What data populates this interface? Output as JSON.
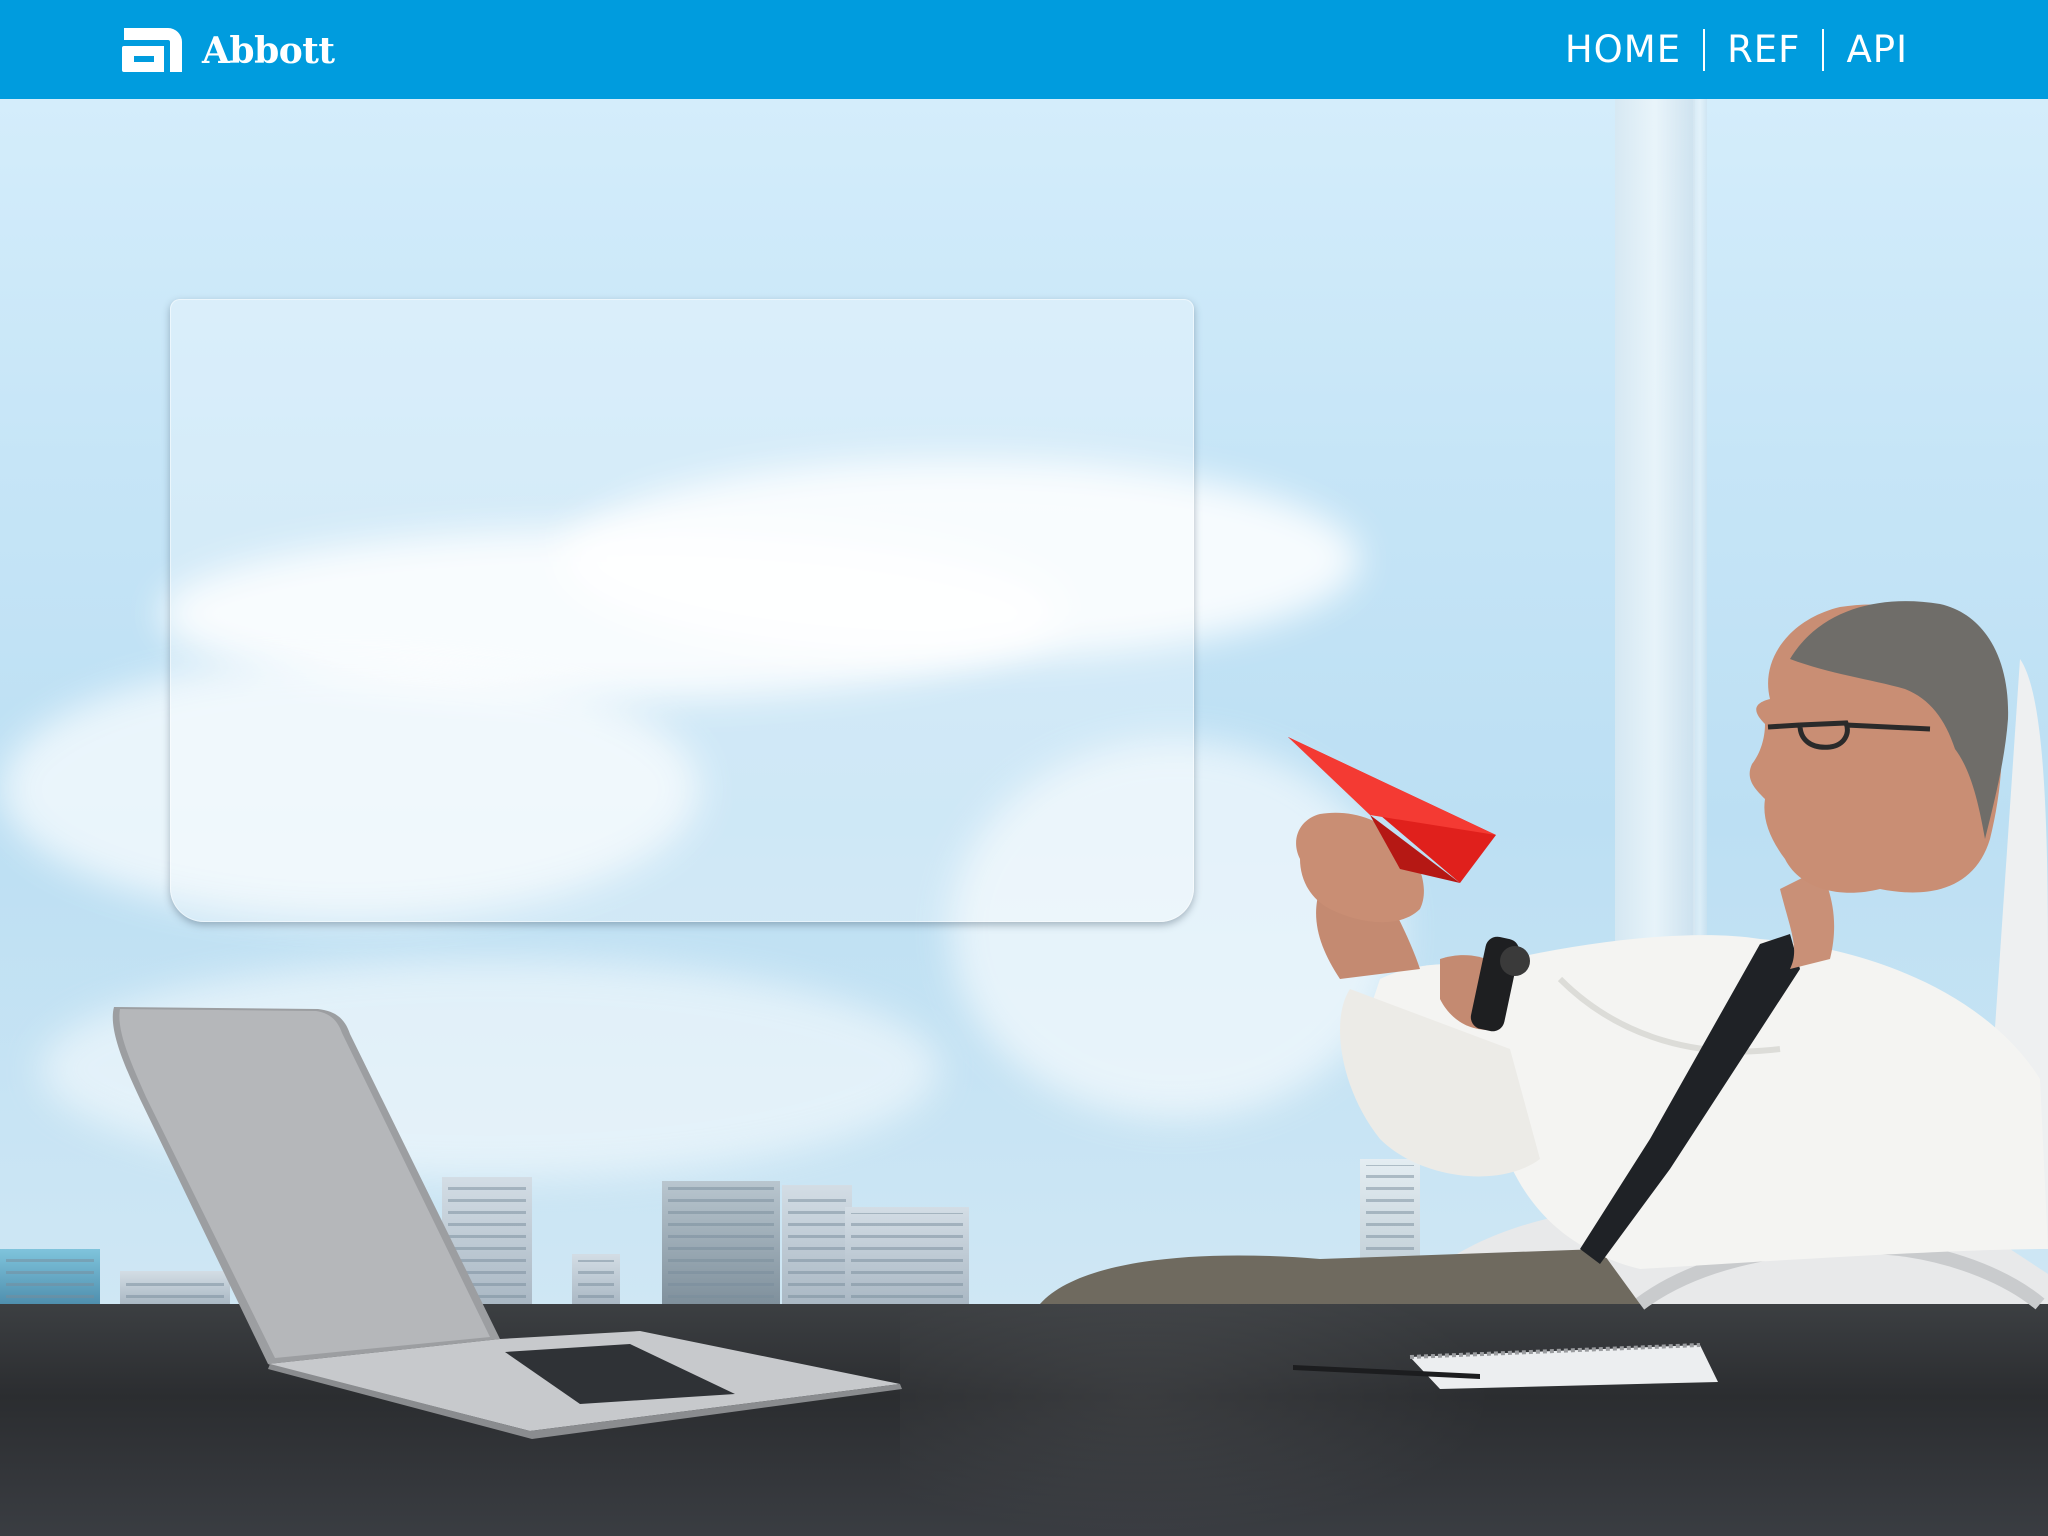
{
  "brand": {
    "name": "Abbott",
    "logo_icon": "abbott-logo-icon",
    "bar_color": "#009cde"
  },
  "nav": {
    "items": [
      {
        "label": "HOME"
      },
      {
        "label": "REF"
      },
      {
        "label": "API"
      }
    ]
  },
  "hero": {
    "photo": "businessman-throwing-paper-airplane-office"
  }
}
